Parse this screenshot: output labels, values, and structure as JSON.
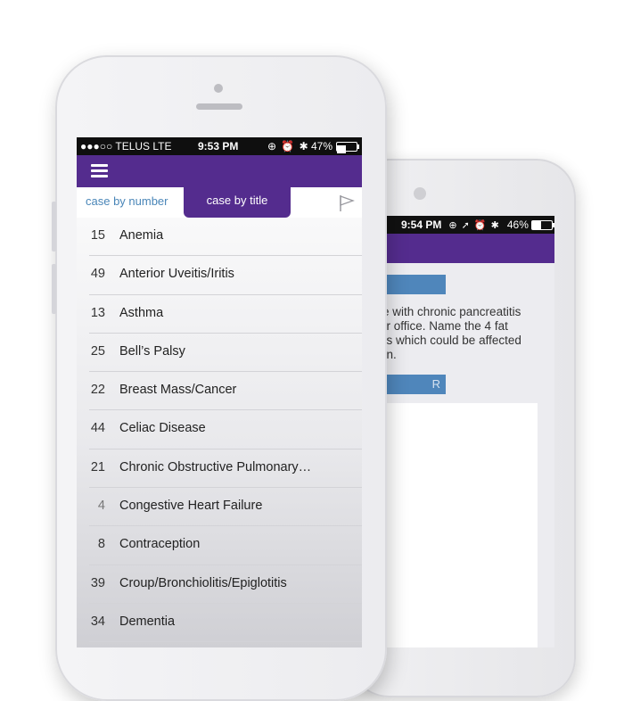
{
  "back_screen": {
    "status": {
      "time": "9:54 PM",
      "icons": "⊕ ➚ ⏰ ✱",
      "battery_pct": "46%",
      "battery_level": 0.46
    },
    "button_top_label": "",
    "button_bottom_label": "R",
    "question_lines": [
      "le with chronic pancreatitis",
      "ur office.  Name the 4 fat",
      "ns which could be affected",
      "on."
    ]
  },
  "front_screen": {
    "status": {
      "carrier": "●●●○○ TELUS  LTE",
      "time": "9:53 PM",
      "icons": "⊕ ⏰ ✱",
      "battery_pct": "47%",
      "battery_level": 0.47
    },
    "tabs": {
      "by_number": "case by number",
      "by_title": "case by title"
    },
    "cases": [
      {
        "number": "15",
        "title": "Anemia"
      },
      {
        "number": "49",
        "title": "Anterior Uveitis/Iritis"
      },
      {
        "number": "13",
        "title": "Asthma"
      },
      {
        "number": "25",
        "title": "Bell’s Palsy"
      },
      {
        "number": "22",
        "title": "Breast Mass/Cancer"
      },
      {
        "number": "44",
        "title": "Celiac Disease"
      },
      {
        "number": "21",
        "title": "Chronic Obstructive Pulmonary…"
      },
      {
        "number": "4",
        "title": "Congestive Heart Failure"
      },
      {
        "number": "8",
        "title": "Contraception"
      },
      {
        "number": "39",
        "title": "Croup/Bronchiolitis/Epiglotitis"
      },
      {
        "number": "34",
        "title": "Dementia"
      }
    ]
  },
  "colors": {
    "brand_purple": "#542c8e",
    "accent_blue": "#4a86b8",
    "status_bar": "#0f0f0f"
  }
}
